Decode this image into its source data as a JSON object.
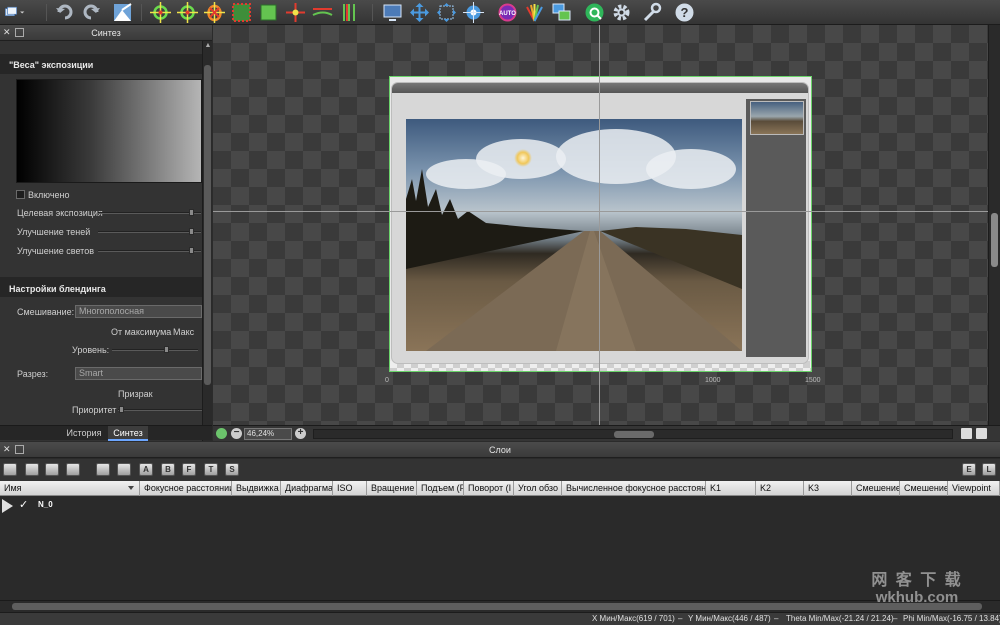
{
  "toolbar": {
    "icons": [
      "layout-menu-icon",
      "undo-icon",
      "redo-icon",
      "image-import-icon",
      "control-points-icon",
      "control-points-fine-icon",
      "remove-control-icon",
      "crop-icon",
      "straighten-icon",
      "grid-align-icon",
      "horizon-icon",
      "vertical-lines-icon",
      "preview-icon",
      "move-icon",
      "warp-icon",
      "center-icon",
      "auto-icon",
      "color-icon",
      "layers-icon",
      "render-icon",
      "settings-icon",
      "tools-icon",
      "help-icon"
    ]
  },
  "left_panel": {
    "title": "Синтез",
    "exposure_section": {
      "title": "\"Веса\" экспозиции",
      "enabled_label": "Включено",
      "sliders": [
        {
          "label": "Целевая экспозиция",
          "value": 0.92
        },
        {
          "label": "Улучшение теней",
          "value": 0.92
        },
        {
          "label": "Улучшение светов",
          "value": 0.92
        }
      ]
    },
    "blend_section": {
      "title": "Настройки блендинга",
      "mix_label": "Смешивание:",
      "mix_value": "Многополосная",
      "from_max_label": "От максимума",
      "max_label": "Макс",
      "level_label": "Уровень:",
      "level_value": 0.6,
      "seam_label": "Разрез:",
      "seam_value": "Smart",
      "ghost_label": "Призрак",
      "priority_label": "Приоритет",
      "priority_value": 0.02
    },
    "tabs": [
      "История",
      "Синтез"
    ],
    "active_tab": "Синтез"
  },
  "preview": {
    "axis_labels": [
      "0",
      "1000",
      "1500"
    ],
    "zoom": "46,24%"
  },
  "layers_panel": {
    "title": "Слои",
    "tool_letters": [
      "A",
      "B",
      "F",
      "T",
      "S"
    ],
    "view_buttons": [
      "E",
      "L"
    ],
    "columns": [
      "Имя",
      "Фокусное расстоянии",
      "Выдвижка",
      "Диафрагма",
      "ISO",
      "Вращение",
      "Подъем (F",
      "Поворот (I",
      "Угол обзо",
      "Вычисленное фокусное расстоянии",
      "K1",
      "K2",
      "K3",
      "Смешение",
      "Смешение",
      "Viewpoint"
    ],
    "rows": [
      {
        "name": "N_0",
        "checked": true
      }
    ]
  },
  "status": {
    "x": "X Мин/Макс(619 / 701)",
    "y": "Y Мин/Макс(446 / 487)",
    "theta": "Theta Min/Max(-21.24 / 21.24)",
    "phi": "Phi Min/Max(-16.75 / 13.84)",
    "sep": "–"
  },
  "watermark": {
    "line1": "网 客 下 载",
    "line2": "wkhub.com"
  }
}
